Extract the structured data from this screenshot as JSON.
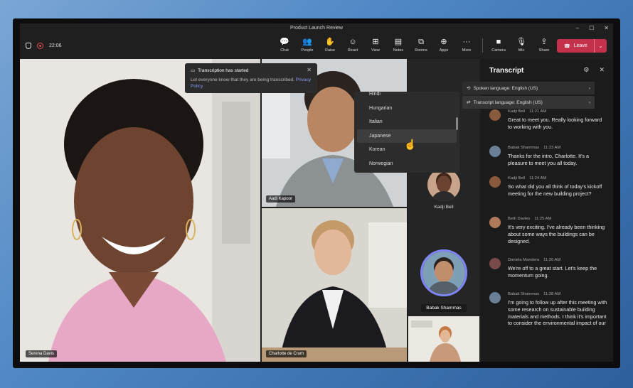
{
  "window": {
    "title": "Product Launch Review",
    "controls": [
      "–",
      "☐",
      "✕"
    ]
  },
  "toolbar": {
    "timer": "22:06",
    "items": [
      {
        "label": "Chat",
        "icon": "chat-icon",
        "glyph": "💬"
      },
      {
        "label": "People",
        "icon": "people-icon",
        "glyph": "👥"
      },
      {
        "label": "Raise",
        "icon": "raise-hand-icon",
        "glyph": "✋"
      },
      {
        "label": "React",
        "icon": "react-icon",
        "glyph": "☺"
      },
      {
        "label": "View",
        "icon": "view-icon",
        "glyph": "⊞"
      },
      {
        "label": "Notes",
        "icon": "notes-icon",
        "glyph": "▤"
      },
      {
        "label": "Rooms",
        "icon": "rooms-icon",
        "glyph": "⧉"
      },
      {
        "label": "Apps",
        "icon": "apps-icon",
        "glyph": "⊕"
      },
      {
        "label": "More",
        "icon": "more-icon",
        "glyph": "···"
      }
    ],
    "media": [
      {
        "label": "Camera",
        "icon": "camera-icon",
        "glyph": "■"
      },
      {
        "label": "Mic",
        "icon": "mic-icon",
        "glyph": "🎙"
      },
      {
        "label": "Share",
        "icon": "share-icon",
        "glyph": "⇪"
      }
    ],
    "leave_label": "Leave",
    "accent": "#c4314b"
  },
  "notice": {
    "title": "Transcription has started",
    "body": "Let everyone know that they are being transcribed.",
    "link": "Privacy Policy"
  },
  "language_list": {
    "items": [
      "Hindi",
      "Hungarian",
      "Italian",
      "Japanese",
      "Korean",
      "Norwegian"
    ],
    "highlighted": "Japanese"
  },
  "participants": {
    "main": "Serena Davis",
    "top": "Aadi Kapoor",
    "bottom": "Charlotte de Crum",
    "side1": "Kadji Bell",
    "side2": "Babak Shammas"
  },
  "transcript": {
    "title": "Transcript",
    "spoken": "Spoken language: English (US)",
    "transcript_lang": "Transcript language: English (US)",
    "messages": [
      {
        "name": "Kadji Bell",
        "time": "11:21 AM",
        "text": "Great to meet you. Really looking forward to working with you.",
        "color": "#8a5a3c"
      },
      {
        "name": "Babak Shammas",
        "time": "11:23 AM",
        "text": "Thanks for the intro, Charlotte. It's a pleasure to meet you all today.",
        "color": "#6a7f95"
      },
      {
        "name": "Kadji Bell",
        "time": "11:24 AM",
        "text": "So what did you all think of today's kickoff meeting for the new building project?",
        "color": "#8a5a3c"
      },
      {
        "name": "Beth Davies",
        "time": "11:25 AM",
        "text": "It's very exciting. I've already been thinking about some ways the buildings can be designed.",
        "color": "#b07a5a"
      },
      {
        "name": "Daniela Mandera",
        "time": "11:26 AM",
        "text": "We're off to a great start. Let's keep the momentum going.",
        "color": "#7a4a4a"
      },
      {
        "name": "Babak Shammas",
        "time": "11:28 AM",
        "text": "I'm going to follow up after this meeting with some research on sustainable building materials and methods. I think it's important to consider the environmental impact of our project",
        "color": "#6a7f95"
      }
    ]
  }
}
